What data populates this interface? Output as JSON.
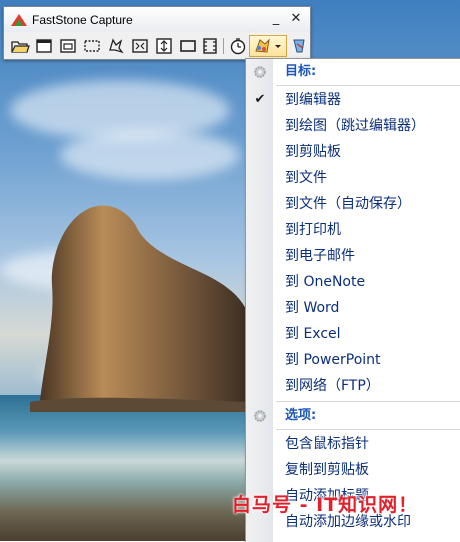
{
  "window": {
    "title": "FastStone Capture",
    "minimize_glyph": "_",
    "close_glyph": "✕"
  },
  "toolbar": {
    "buttons": [
      {
        "icon": "open-folder-icon"
      },
      {
        "icon": "capture-window-icon"
      },
      {
        "icon": "capture-object-icon"
      },
      {
        "icon": "capture-rectangle-icon"
      },
      {
        "icon": "capture-freehand-icon"
      },
      {
        "icon": "capture-fullscreen-icon"
      },
      {
        "icon": "capture-scrolling-icon"
      },
      {
        "icon": "capture-fixed-region-icon"
      },
      {
        "icon": "screen-recorder-icon"
      },
      {
        "icon": "delay-timer-icon"
      },
      {
        "icon": "output-destination-icon"
      },
      {
        "icon": "settings-icon"
      }
    ]
  },
  "menu": {
    "target_header": "目标:",
    "items": [
      {
        "label": "到编辑器",
        "checked": true
      },
      {
        "label": "到绘图（跳过编辑器）",
        "checked": false
      },
      {
        "label": "到剪贴板",
        "checked": false
      },
      {
        "label": "到文件",
        "checked": false
      },
      {
        "label": "到文件（自动保存）",
        "checked": false
      },
      {
        "label": "到打印机",
        "checked": false
      },
      {
        "label": "到电子邮件",
        "checked": false
      },
      {
        "label": "到 OneNote",
        "checked": false
      },
      {
        "label": "到 Word",
        "checked": false
      },
      {
        "label": "到 Excel",
        "checked": false
      },
      {
        "label": "到 PowerPoint",
        "checked": false
      },
      {
        "label": "到网络（FTP）",
        "checked": false
      }
    ],
    "options_header": "选项:",
    "options": [
      {
        "label": "包含鼠标指针"
      },
      {
        "label": "复制到剪贴板"
      },
      {
        "label": "自动添加标题"
      },
      {
        "label": "自动添加边缘或水印"
      }
    ],
    "check_glyph": "✔"
  },
  "watermark": "白马号 - IT知识网！",
  "colors": {
    "menu_text": "#0b2f7a",
    "menu_header": "#1c57b8",
    "watermark": "#e2202b"
  }
}
